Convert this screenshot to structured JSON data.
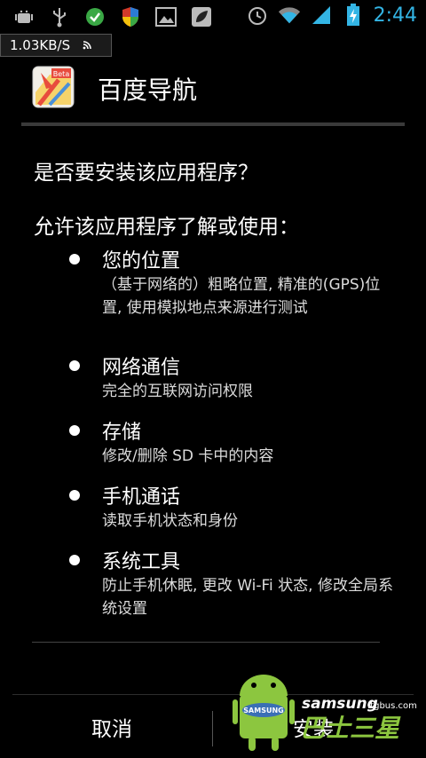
{
  "status_bar": {
    "time": "2:44",
    "left_icons": [
      "android-debug-icon",
      "usb-icon",
      "check-circle-icon",
      "shield-icon",
      "image-icon",
      "leaf-icon"
    ],
    "right_icons": [
      "alarm-icon",
      "wifi-icon",
      "signal-icon",
      "battery-charging-icon"
    ]
  },
  "netspeed": {
    "text": "1.03KB/S"
  },
  "app": {
    "name": "百度导航",
    "icon_badge": "Beta"
  },
  "dialog": {
    "question": "是否要安装该应用程序？",
    "allow_label": "允许该应用程序了解或使用：",
    "permissions": [
      {
        "title": "您的位置",
        "desc": "（基于网络的）粗略位置, 精准的(GPS)位置, 使用模拟地点来源进行测试"
      },
      {
        "title": "网络通信",
        "desc": "完全的互联网访问权限"
      },
      {
        "title": "存储",
        "desc": "修改/删除 SD 卡中的内容"
      },
      {
        "title": "手机通话",
        "desc": "读取手机状态和身份"
      },
      {
        "title": "系统工具",
        "desc": "防止手机休眠, 更改 Wi-Fi 状态, 修改全局系统设置"
      }
    ]
  },
  "buttons": {
    "cancel": "取消",
    "install": "安装"
  },
  "watermark": {
    "badge": "SAMSUNG",
    "site": "samsung",
    "domain": ".tgbus.com",
    "brand": "巴士三星"
  },
  "colors": {
    "clock": "#33b5e5",
    "background": "#000000",
    "watermark_green": "#8cc63f"
  }
}
